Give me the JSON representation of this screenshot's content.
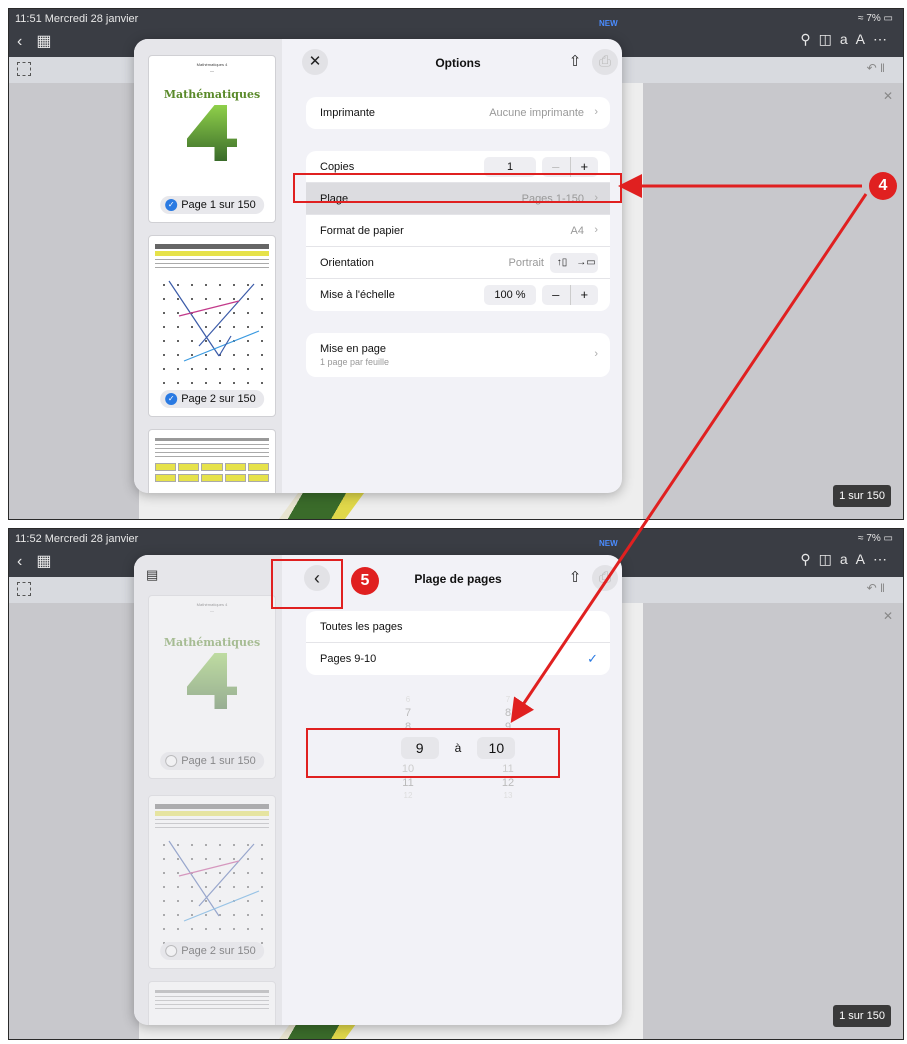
{
  "shot1": {
    "status_time": "11:51 Mercredi 28 janvier",
    "battery": "7%",
    "new_badge": "NEW",
    "page_counter": "1 sur 150",
    "title": "Options",
    "thumbs": [
      {
        "label": "Page 1 sur 150",
        "math_title": "Mathématiques"
      },
      {
        "label": "Page 2 sur 150"
      }
    ],
    "rows": {
      "printer_label": "Imprimante",
      "printer_value": "Aucune imprimante",
      "copies_label": "Copies",
      "copies_value": "1",
      "range_label": "Plage",
      "range_value": "Pages 1-150",
      "paper_label": "Format de papier",
      "paper_value": "A4",
      "orientation_label": "Orientation",
      "orientation_value": "Portrait",
      "scale_label": "Mise à l'échelle",
      "scale_value": "100 %",
      "layout_label": "Mise en page",
      "layout_sub": "1 page par feuille"
    }
  },
  "shot2": {
    "status_time": "11:52 Mercredi 28 janvier",
    "battery": "7%",
    "new_badge": "NEW",
    "page_counter": "1 sur 150",
    "title": "Plage de pages",
    "thumbs": [
      {
        "label": "Page 1 sur 150",
        "math_title": "Mathématiques"
      },
      {
        "label": "Page 2 sur 150"
      }
    ],
    "options": {
      "all_pages": "Toutes les pages",
      "custom": "Pages 9-10"
    },
    "picker": {
      "from_above": [
        "6",
        "7",
        "8"
      ],
      "from_selected": "9",
      "from_below": [
        "10",
        "11",
        "12"
      ],
      "separator": "à",
      "to_above": [
        "7",
        "8",
        "9"
      ],
      "to_selected": "10",
      "to_below": [
        "11",
        "12",
        "13"
      ]
    }
  },
  "annotations": {
    "callout_4": "4",
    "callout_5": "5",
    "color": "#e02020"
  }
}
